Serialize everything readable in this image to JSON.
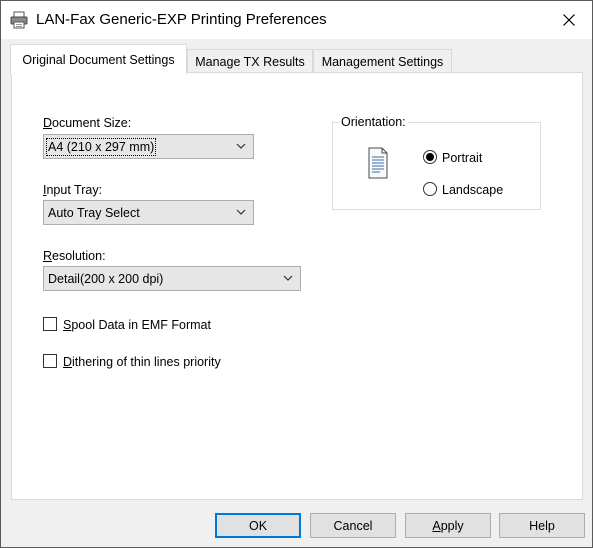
{
  "window": {
    "title": "LAN-Fax Generic-EXP Printing Preferences"
  },
  "tabs": [
    {
      "label": "Original Document Settings",
      "active": true
    },
    {
      "label": "Manage TX Results",
      "active": false
    },
    {
      "label": "Management Settings",
      "active": false
    }
  ],
  "document_size": {
    "label_prefix": "D",
    "label_rest": "ocument Size:",
    "value": "A4 (210 x 297 mm)"
  },
  "input_tray": {
    "label_prefix": "I",
    "label_rest": "nput Tray:",
    "value": "Auto Tray Select"
  },
  "resolution": {
    "label_prefix": "R",
    "label_rest": "esolution:",
    "value": "Detail(200 x 200 dpi)"
  },
  "checkboxes": [
    {
      "label_prefix": "S",
      "label_rest": "pool Data in EMF Format",
      "checked": false
    },
    {
      "label_prefix": "D",
      "label_rest": "ithering of thin lines priority",
      "checked": false
    }
  ],
  "orientation": {
    "legend": "Orientation:",
    "options": [
      {
        "label": "Portrait",
        "selected": true
      },
      {
        "label": "Landscape",
        "selected": false
      }
    ],
    "icon": "portrait-page-icon"
  },
  "buttons": {
    "ok": "OK",
    "cancel": "Cancel",
    "apply_prefix": "A",
    "apply_rest": "pply",
    "help": "Help"
  },
  "colors": {
    "default_button_border": "#0078d7",
    "panel_background": "#ffffff",
    "dialog_background": "#f0f0f0"
  }
}
